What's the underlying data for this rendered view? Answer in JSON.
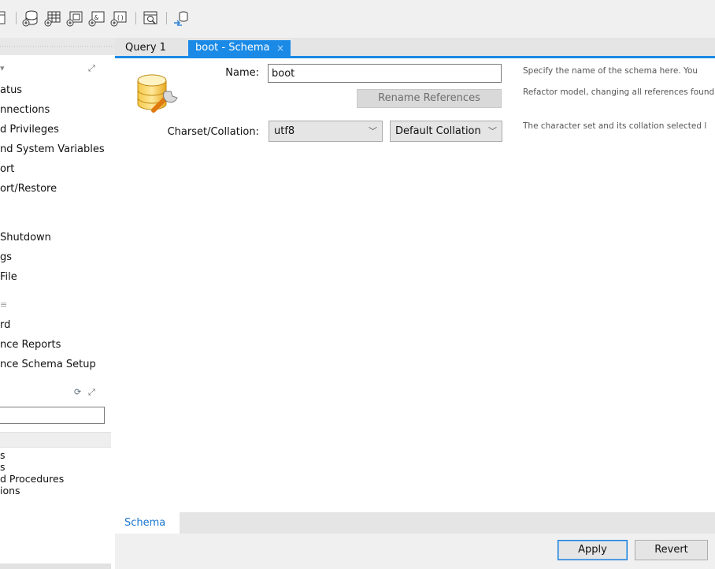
{
  "toolbar": {
    "icons": [
      "new-sql-tab-icon",
      "open-sql-script-icon",
      "create-schema-icon",
      "create-table-icon",
      "create-view-icon",
      "create-procedure-icon",
      "create-function-icon",
      "search-table-data-icon",
      "reconnect-icon"
    ]
  },
  "sidebar": {
    "management_items": [
      "atus",
      "nnections",
      "d Privileges",
      "nd System Variables",
      "ort",
      "ort/Restore"
    ],
    "instance_items": [
      "Shutdown",
      "gs",
      "File"
    ],
    "performance_items": [
      "rd",
      "nce Reports",
      "nce Schema Setup"
    ],
    "object_items": [
      "s",
      "s",
      "d Procedures",
      "ions"
    ],
    "search_value": ""
  },
  "tabs": {
    "query_tab": "Query 1",
    "schema_tab": "boot - Schema",
    "close_glyph": "×"
  },
  "form": {
    "name_label": "Name:",
    "name_value": "boot",
    "rename_button": "Rename References",
    "charset_label": "Charset/Collation:",
    "charset_value": "utf8",
    "collation_value": "Default Collation",
    "help_name": "Specify the name of the schema here. You",
    "help_rename": "Refactor model, changing all references found i",
    "help_charset": "The character set and its collation selected l"
  },
  "bottom": {
    "schema_tab": "Schema",
    "apply_button": "Apply",
    "revert_button": "Revert"
  },
  "colors": {
    "accent": "#1a8ae6",
    "toolbar_bg": "#f0f0f0",
    "tab_bg": "#e5e5e5"
  }
}
